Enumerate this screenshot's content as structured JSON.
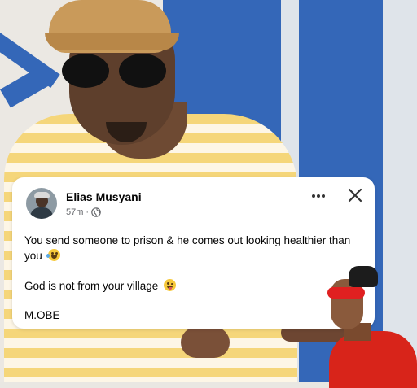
{
  "post": {
    "author_name": "Elias Musyani",
    "timestamp": "57m",
    "separator": "·",
    "privacy_icon": "globe-icon",
    "more_icon": "more-options-icon",
    "close_icon": "close-icon",
    "lines": [
      "You send someone to prison & he comes out looking healthier than",
      "you",
      "God is not from your village",
      "M.OBE"
    ],
    "emojis": [
      "laughing-crying-emoji",
      "winking-tongue-emoji"
    ]
  },
  "colors": {
    "card_bg": "#ffffff",
    "text_primary": "#050505",
    "text_secondary": "#65676b",
    "wall_blue": "#3467b8",
    "shirt_yellow": "#f5d67a"
  }
}
